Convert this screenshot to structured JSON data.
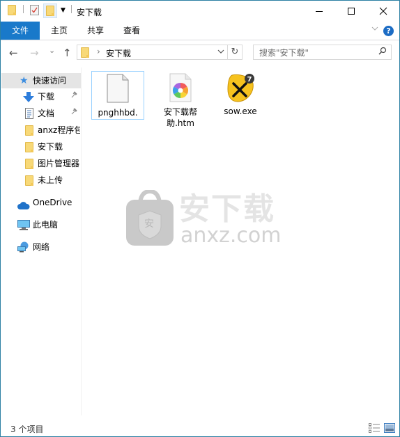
{
  "window": {
    "title": "安下载",
    "controls": {
      "minimize": "—",
      "maximize": "☐",
      "close": "✕"
    }
  },
  "ribbon": {
    "tabs": [
      {
        "label": "文件",
        "active": true
      },
      {
        "label": "主页"
      },
      {
        "label": "共享"
      },
      {
        "label": "查看"
      }
    ],
    "help_label": "?",
    "accent_color": "#1979ca"
  },
  "navigation": {
    "back": "←",
    "forward": "→",
    "recent": "⌄",
    "up": "↑",
    "address": {
      "separator": "›",
      "location": "安下载",
      "dropdown": "⌄",
      "refresh": "↻"
    },
    "search": {
      "placeholder": "搜索\"安下载\"",
      "value": ""
    }
  },
  "sidebar": {
    "items": [
      {
        "label": "快速访问",
        "icon": "star-icon",
        "selected": true
      },
      {
        "label": "下载",
        "icon": "download-icon",
        "pinned": true
      },
      {
        "label": "文档",
        "icon": "document-icon",
        "pinned": true
      },
      {
        "label": "anxz程序包",
        "icon": "folder-icon"
      },
      {
        "label": "安下载",
        "icon": "folder-icon"
      },
      {
        "label": "图片管理器",
        "icon": "folder-icon"
      },
      {
        "label": "未上传",
        "icon": "folder-icon"
      },
      {
        "label": "OneDrive",
        "icon": "cloud-icon"
      },
      {
        "label": "此电脑",
        "icon": "computer-icon"
      },
      {
        "label": "网络",
        "icon": "network-icon"
      }
    ],
    "pin_glyph": "📌"
  },
  "files": [
    {
      "name": "pnghhbd.",
      "icon": "blank-file-icon",
      "selected": true
    },
    {
      "name_line1": "安下载帮",
      "name_line2": "助.htm",
      "icon": "html-file-icon"
    },
    {
      "name": "sow.exe",
      "icon": "exe-app-icon"
    }
  ],
  "watermark": {
    "title": "安下载",
    "subtitle": "anxz.com",
    "badge": "安"
  },
  "status": {
    "item_count": "3 个项目"
  }
}
